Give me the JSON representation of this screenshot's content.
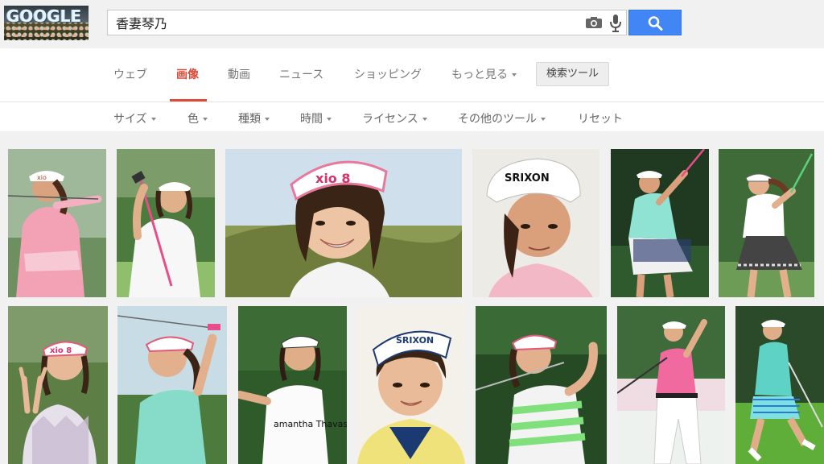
{
  "header": {
    "logo_text": "GOOGLE",
    "search_query": "香妻琴乃"
  },
  "tabs": [
    {
      "label": "ウェブ",
      "active": false
    },
    {
      "label": "画像",
      "active": true
    },
    {
      "label": "動画",
      "active": false
    },
    {
      "label": "ニュース",
      "active": false
    },
    {
      "label": "ショッピング",
      "active": false
    },
    {
      "label": "もっと見る",
      "active": false
    }
  ],
  "search_tools_label": "検索ツール",
  "tools": [
    {
      "label": "サイズ",
      "dropdown": true
    },
    {
      "label": "色",
      "dropdown": true
    },
    {
      "label": "種類",
      "dropdown": true
    },
    {
      "label": "時間",
      "dropdown": true
    },
    {
      "label": "ライセンス",
      "dropdown": true
    },
    {
      "label": "その他のツール",
      "dropdown": true
    },
    {
      "label": "リセット",
      "dropdown": false
    }
  ],
  "visor_texts": {
    "visor_1": "xio",
    "visor_4": "xio 8",
    "visor_5": "SRIXON",
    "visor_8": "xio 8",
    "visor_11": "SRIXON",
    "shirt_10": "amantha Thavasa"
  },
  "colors": {
    "accent_tab": "#dd4b39",
    "search_button": "#4285f4",
    "header_bg": "#f1f1f1"
  }
}
